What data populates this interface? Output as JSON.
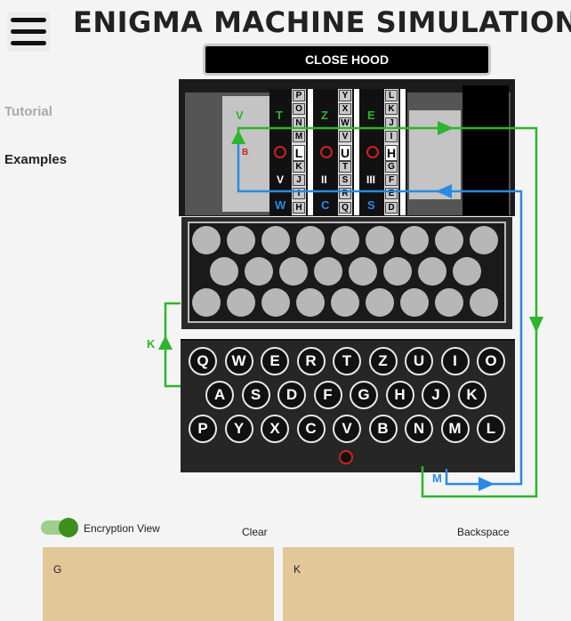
{
  "header": {
    "title": "ENIGMA MACHINE SIMULATION",
    "hood_button": "CLOSE HOOD"
  },
  "sidebar": {
    "items": [
      {
        "label": "Tutorial",
        "color": "#aaaaaa"
      },
      {
        "label": "Examples",
        "color": "#222222"
      }
    ]
  },
  "rotors": {
    "entry_letter": "V",
    "reflector_label": "B",
    "units": [
      {
        "top": "T",
        "numeral": "V",
        "bottom": "W",
        "strip": [
          "P",
          "O",
          "N",
          "M",
          "L",
          "K",
          "J",
          "I",
          "H"
        ]
      },
      {
        "top": "Z",
        "numeral": "II",
        "bottom": "C",
        "strip": [
          "Y",
          "X",
          "W",
          "V",
          "U",
          "T",
          "S",
          "R",
          "Q"
        ]
      },
      {
        "top": "E",
        "numeral": "III",
        "bottom": "S",
        "strip": [
          "L",
          "K",
          "J",
          "I",
          "H",
          "G",
          "F",
          "E",
          "D"
        ]
      }
    ]
  },
  "keyboard": {
    "rows": [
      [
        "Q",
        "W",
        "E",
        "R",
        "T",
        "Z",
        "U",
        "I",
        "O"
      ],
      [
        "A",
        "S",
        "D",
        "F",
        "G",
        "H",
        "J",
        "K"
      ],
      [
        "P",
        "Y",
        "X",
        "C",
        "V",
        "B",
        "N",
        "M",
        "L"
      ]
    ]
  },
  "wires": {
    "input_label": "K",
    "output_label": "M",
    "input_color": "#2db52d",
    "output_color": "#2a8ae2"
  },
  "controls": {
    "encryption_view_label": "Encryption View",
    "encryption_view_on": true,
    "clear_label": "Clear",
    "backspace_label": "Backspace"
  },
  "input_text": "G",
  "output_text": "K"
}
